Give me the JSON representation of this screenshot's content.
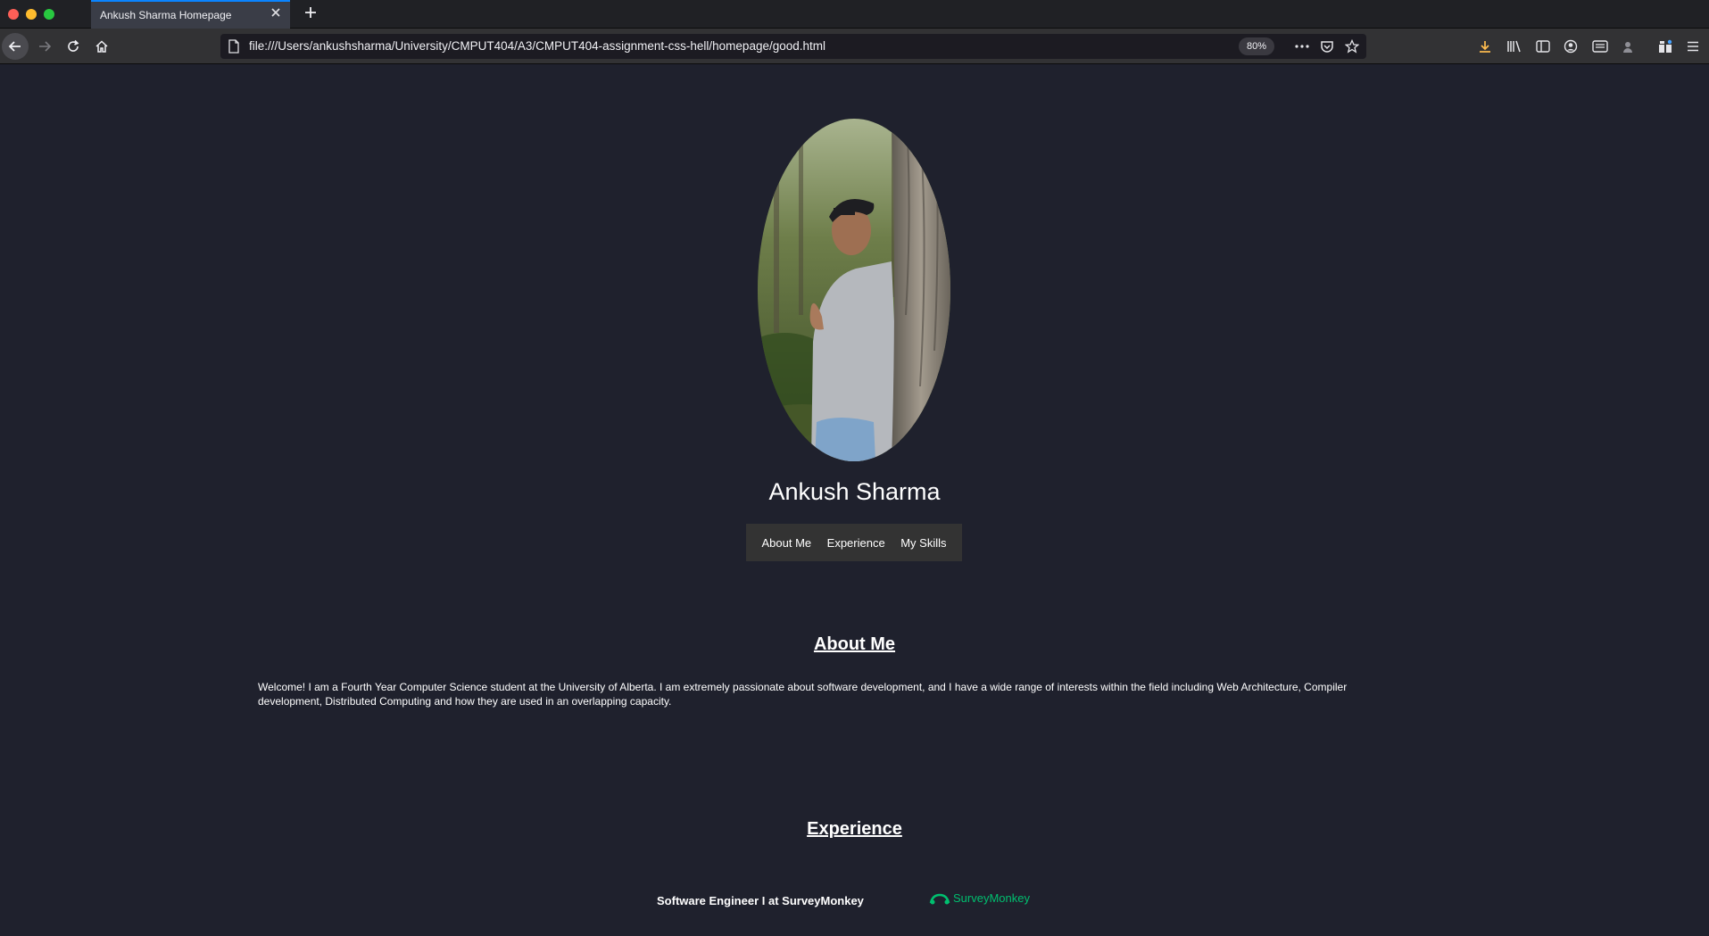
{
  "browser": {
    "tab": {
      "title": "Ankush Sharma Homepage"
    },
    "url": "file:///Users/ankushsharma/University/CMPUT404/A3/CMPUT404-assignment-css-hell/homepage/good.html",
    "zoom": "80%"
  },
  "page": {
    "name": "Ankush Sharma",
    "nav": [
      "About Me",
      "Experience",
      "My Skills"
    ],
    "about": {
      "title": "About Me",
      "text": "Welcome! I am a Fourth Year Computer Science student at the University of Alberta. I am extremely passionate about software development, and I have a wide range of interests within the field including Web Architecture, Compiler development, Distributed Computing and how they are used in an overlapping capacity."
    },
    "experience": {
      "title": "Experience",
      "role": "Software Engineer I at SurveyMonkey",
      "logo_text": "SurveyMonkey"
    }
  },
  "colors": {
    "page_bg": "#1f212d",
    "menu_bg": "#333333",
    "brand_green": "#00bf6f"
  },
  "icons": {
    "nav": [
      "back-arrow-icon",
      "forward-arrow-icon",
      "reload-icon",
      "home-icon"
    ],
    "url_actions": [
      "page-actions-icon",
      "pocket-icon",
      "bookmark-star-icon"
    ],
    "toolbar": [
      "download-icon",
      "library-icon",
      "sidebar-icon",
      "account-icon",
      "reader-view-icon",
      "extension-icon",
      "overflow-icon",
      "hamburger-menu-icon"
    ]
  }
}
